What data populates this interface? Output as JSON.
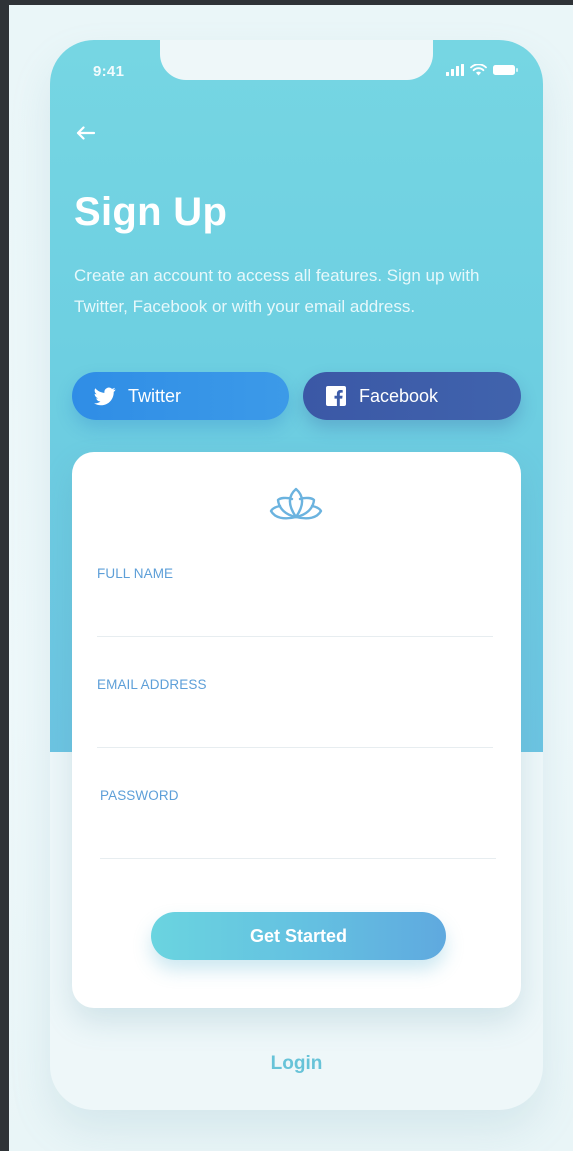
{
  "status_bar": {
    "time": "9:41"
  },
  "header": {
    "back_icon": "arrow-left-icon",
    "title": "Sign Up",
    "subtitle": "Create an account to access all features. Sign up with Twitter, Facebook or with your email address."
  },
  "social": {
    "twitter": {
      "label": "Twitter",
      "icon": "twitter-bird-icon",
      "color": "#3592e7"
    },
    "facebook": {
      "label": "Facebook",
      "icon": "facebook-f-icon",
      "color": "#3d5ca9"
    }
  },
  "form": {
    "logo_icon": "lotus-icon",
    "fields": [
      {
        "label": "FULL NAME",
        "value": ""
      },
      {
        "label": "EMAIL ADDRESS",
        "value": ""
      },
      {
        "label": "PASSWORD",
        "value": ""
      }
    ],
    "submit_label": "Get Started"
  },
  "footer": {
    "login_label": "Login"
  },
  "colors": {
    "hero_top": "#76d6e3",
    "hero_bottom": "#6cc4e2",
    "accent_label": "#5d9fd8",
    "login_text": "#67c3d8"
  }
}
